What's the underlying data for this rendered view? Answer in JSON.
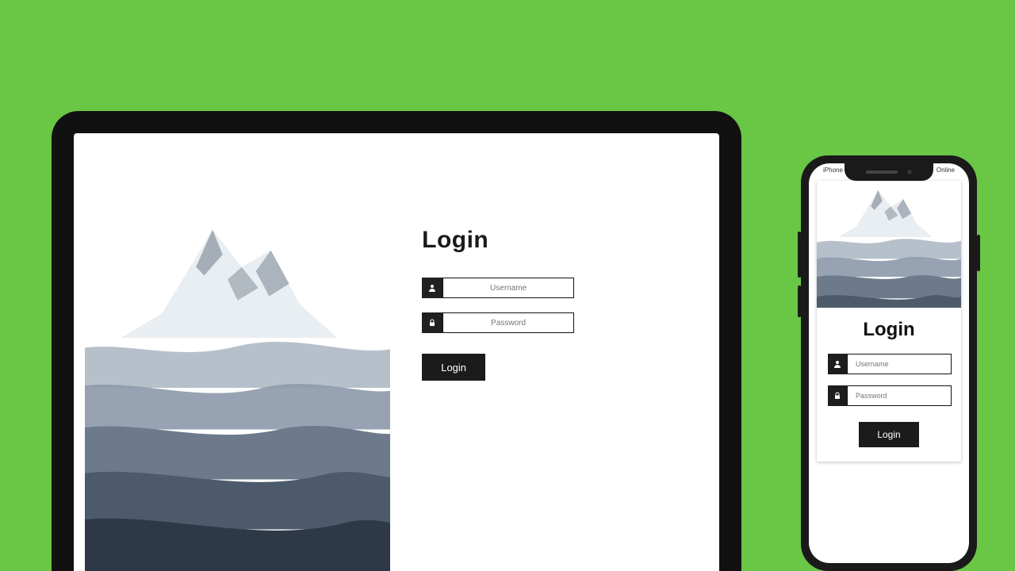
{
  "laptop": {
    "login": {
      "title": "Login",
      "username_placeholder": "Username",
      "password_placeholder": "Password",
      "button_label": "Login"
    }
  },
  "phone": {
    "status_left": "iPhone",
    "status_right": "Online",
    "login": {
      "title": "Login",
      "username_placeholder": "Username",
      "password_placeholder": "Password",
      "button_label": "Login"
    }
  }
}
